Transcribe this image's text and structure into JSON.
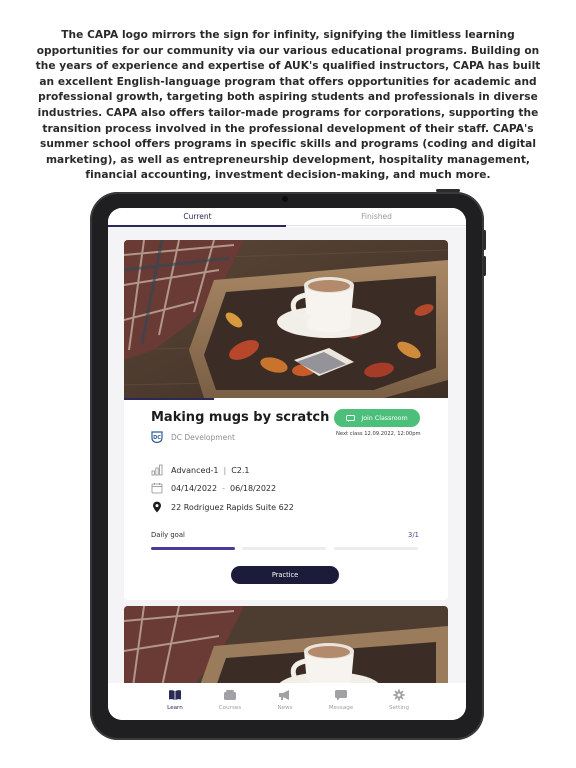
{
  "intro_text": "The CAPA logo mirrors the sign for infinity, signifying the limitless learning opportunities for our community via our various educational programs. Building on the years of experience and expertise of AUK's qualified instructors, CAPA has built an excellent English-language program that offers opportunities for academic and professional growth, targeting both aspiring students and professionals in diverse industries. CAPA also offers tailor-made programs for corporations, supporting the transition process involved in the professional development of their staff. CAPA's summer school offers programs in specific skills and programs (coding and digital marketing), as well as entrepreneurship development, hospitality management, financial accounting, investment decision-making, and much more.",
  "tabs": {
    "current": "Current",
    "finished": "Finished"
  },
  "course": {
    "title": "Making mugs by scratch",
    "organization": "DC Development",
    "join_label": "Join Classroom",
    "next_class": "Next class 12.09.2022, 12:00pm",
    "level": "Advanced-1",
    "level_sep": "|",
    "level_code": "C2.1",
    "date_start": "04/14/2022",
    "date_sep": "-",
    "date_end": "06/18/2022",
    "address": "22 Rodriguez Rapids Suite 622",
    "goal_label": "Daily goal",
    "goal_count": "3/1",
    "practice_label": "Practice"
  },
  "progress": {
    "segments_total": 3,
    "segments_done": 1
  },
  "nav": [
    {
      "label": "Learn",
      "icon": "book-icon",
      "active": true
    },
    {
      "label": "Courses",
      "icon": "courses-icon",
      "active": false
    },
    {
      "label": "News",
      "icon": "megaphone-icon",
      "active": false
    },
    {
      "label": "Message",
      "icon": "chat-bubble-icon",
      "active": false
    },
    {
      "label": "Setting",
      "icon": "gear-icon",
      "active": false
    }
  ],
  "colors": {
    "accent": "#2b2a57",
    "join": "#4cc07a",
    "progress": "#4b3a9c",
    "practice": "#1c1b3a"
  }
}
